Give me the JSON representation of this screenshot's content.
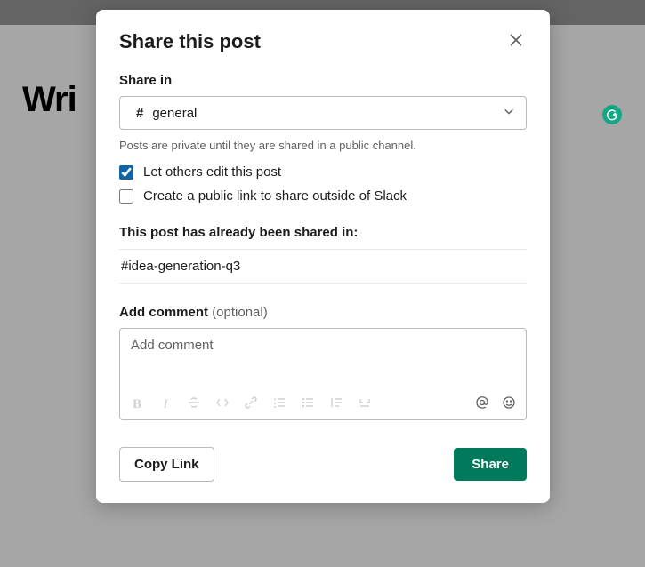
{
  "background": {
    "page_title_fragment": "Wri"
  },
  "modal": {
    "title": "Share this post",
    "share_in_label": "Share in",
    "channel": {
      "prefix": "#",
      "name": "general"
    },
    "privacy_hint": "Posts are private until they are shared in a public channel.",
    "checkboxes": {
      "edit": {
        "label": "Let others edit this post",
        "checked": true
      },
      "public_link": {
        "label": "Create a public link to share outside of Slack",
        "checked": false
      }
    },
    "already_shared_label": "This post has already been shared in:",
    "already_shared_channels": [
      "#idea-generation-q3"
    ],
    "comment": {
      "label": "Add comment",
      "optional": "(optional)",
      "placeholder": "Add comment"
    },
    "footer": {
      "copy_link": "Copy Link",
      "share": "Share"
    }
  }
}
